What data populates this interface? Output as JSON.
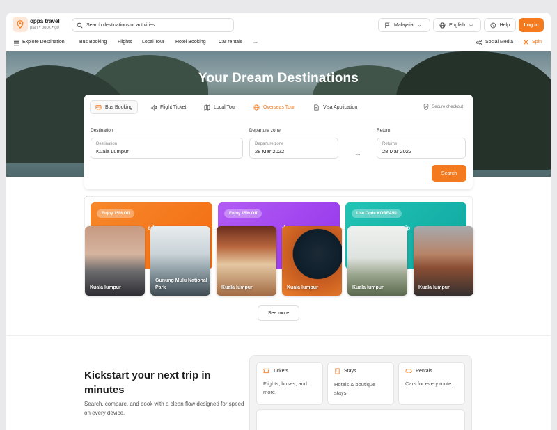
{
  "header": {
    "brand_name": "oppa travel",
    "brand_tagline": "plan • book • go",
    "search_placeholder": "Search destinations or activities",
    "country": "Malaysia",
    "language": "English",
    "help": "Help",
    "login": "Log in"
  },
  "nav": {
    "items": [
      "Explore Destination",
      "Bus Booking",
      "Flights",
      "Local Tour",
      "Hotel Booking",
      "Car rentals",
      "..."
    ],
    "social": "Social Media",
    "spin": "Spin"
  },
  "hero": {
    "title": "Your Dream Destinations"
  },
  "booking": {
    "tabs": [
      "Bus Booking",
      "Flight Ticket",
      "Local Tour",
      "Overseas Tour",
      "Visa Application"
    ],
    "secure": "Secure checkout",
    "destination_label": "Destination",
    "destination_placeholder": "Destination",
    "destination_value": "Kuala Lumpur",
    "departure_label": "Departure zone",
    "departure_placeholder": "Departure zone",
    "departure_value": "28 Mar 2022",
    "return_label": "Return",
    "return_placeholder": "Returns",
    "return_value": "28 Mar 2022",
    "search_button": "Search"
  },
  "promos": {
    "heading_clipped": "Ad",
    "cards": [
      {
        "badge": "Enjoy 15% Off",
        "text": "ed"
      },
      {
        "badge": "Enjoy 15% Off",
        "text": "d"
      },
      {
        "badge": "Use Code  KOREA50",
        "text": "ip"
      }
    ]
  },
  "destinations": [
    {
      "name": "Kuala lumpur"
    },
    {
      "name": "Gunung Mulu National Park"
    },
    {
      "name": "Kuala lumpur"
    },
    {
      "name": "Kuala lumpur"
    },
    {
      "name": "Kuala lumpur"
    },
    {
      "name": "Kuala lumpur"
    }
  ],
  "see_more": "See more",
  "kickstart": {
    "title": "Kickstart your next trip in minutes",
    "subtitle": "Search, compare, and book with a clean flow designed for speed on every device.",
    "cards": [
      {
        "title": "Tickets",
        "desc": "Flights, buses, and more."
      },
      {
        "title": "Stays",
        "desc": "Hotels & boutique stays."
      },
      {
        "title": "Rentals",
        "desc": "Cars for every route."
      }
    ]
  },
  "colors": {
    "accent": "#f47a1f",
    "promo1": "#f47a1f",
    "promo2": "#a855f7",
    "promo3": "#14b8a6"
  }
}
